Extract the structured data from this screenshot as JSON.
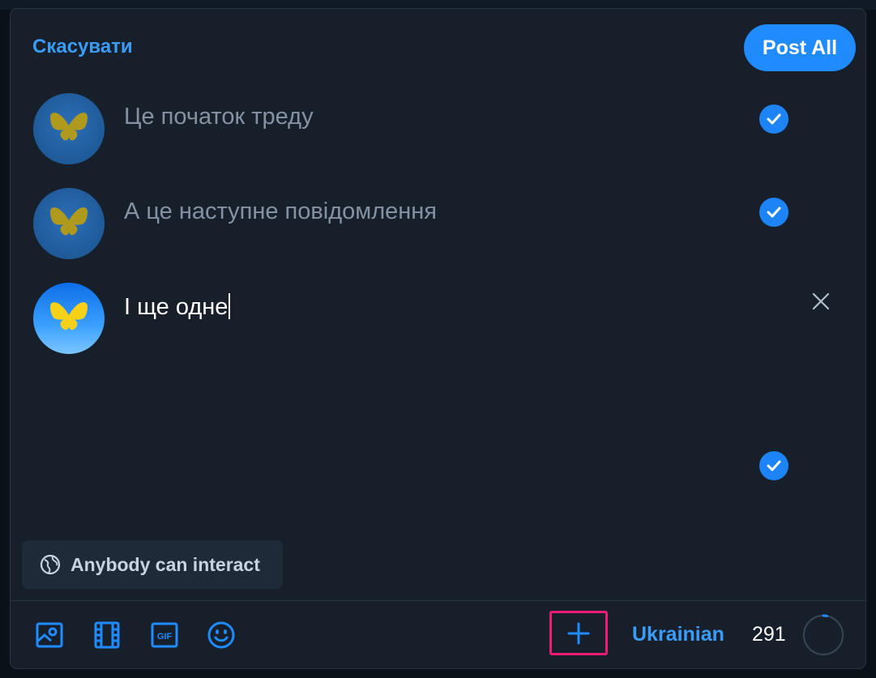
{
  "header": {
    "cancel_label": "Скасувати",
    "post_all_label": "Post All"
  },
  "thread": {
    "posts": [
      {
        "text": "Це початок треду",
        "active": false,
        "status": "check-icon"
      },
      {
        "text": "А це наступне повідомлення",
        "active": false,
        "status": "check-icon"
      },
      {
        "text": "І ще одне",
        "active": true,
        "status": "close-icon"
      }
    ],
    "extra_check": "check-icon"
  },
  "interaction": {
    "label": "Anybody can interact",
    "icon": "globe-icon"
  },
  "toolbar": {
    "icons": [
      "image-icon",
      "video-icon",
      "gif-icon",
      "emoji-icon",
      "add-post-icon"
    ],
    "language": "Ukrainian",
    "char_count": "291",
    "progress_fraction": 0.03
  },
  "colors": {
    "accent": "#208bfe",
    "link": "#3b9cf7",
    "highlight": "#ee1c74",
    "butterfly": "#b09a1e",
    "butterfly_active": "#f7d117"
  }
}
